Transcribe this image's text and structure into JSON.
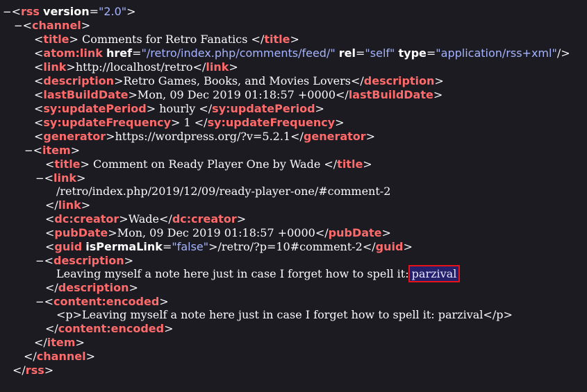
{
  "rss": {
    "tag": "rss",
    "version_attr": "version",
    "version_val": "\"2.0\""
  },
  "channel": {
    "tag": "channel",
    "title": {
      "tag": "title",
      "text": " Comments for Retro Fanatics "
    },
    "atom": {
      "tag": "atom:link",
      "href_attr": "href",
      "href_val": "\"/retro/index.php/comments/feed/\"",
      "rel_attr": "rel",
      "rel_val": "\"self\"",
      "type_attr": "type",
      "type_val": "\"application/rss+xml\""
    },
    "link": {
      "tag": "link",
      "text": "http://localhost/retro"
    },
    "description": {
      "tag": "description",
      "text": "Retro Games, Books, and Movies Lovers"
    },
    "lastBuildDate": {
      "tag": "lastBuildDate",
      "text": "Mon, 09 Dec 2019 01:18:57 +0000"
    },
    "updatePeriod": {
      "tag": "sy:updatePeriod",
      "text": " hourly "
    },
    "updateFrequency": {
      "tag": "sy:updateFrequency",
      "text": " 1 "
    },
    "generator": {
      "tag": "generator",
      "text": "https://wordpress.org/?v=5.2.1"
    }
  },
  "item": {
    "tag": "item",
    "title": {
      "tag": "title",
      "text": " Comment on Ready Player One by Wade "
    },
    "link": {
      "tag": "link",
      "text": "/retro/index.php/2019/12/09/ready-player-one/#comment-2"
    },
    "creator": {
      "tag": "dc:creator",
      "text": "Wade"
    },
    "pubDate": {
      "tag": "pubDate",
      "text": "Mon, 09 Dec 2019 01:18:57 +0000"
    },
    "guid": {
      "tag": "guid",
      "attr": "isPermaLink",
      "attr_val": "\"false\"",
      "text": "/retro/?p=10#comment-2"
    },
    "description": {
      "tag": "description",
      "text": "Leaving myself a note here just in case I forget how to spell it: ",
      "highlight": "parzival"
    },
    "content": {
      "tag": "content:encoded",
      "text": "<p>Leaving myself a note here just in case I forget how to spell it: parzival</p>"
    }
  },
  "toggle_glyph": "−"
}
